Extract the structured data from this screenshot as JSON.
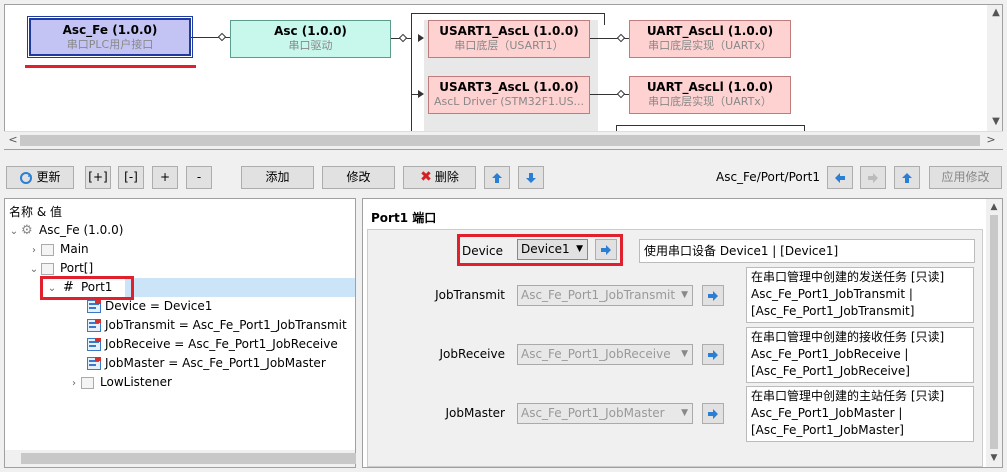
{
  "diagram": {
    "nodes": {
      "asc_fe": {
        "title": "Asc_Fe (1.0.0)",
        "sub": "串口PLC用户接口"
      },
      "asc": {
        "title": "Asc (1.0.0)",
        "sub": "串口驱动"
      },
      "usart1": {
        "title": "USART1_AscL (1.0.0)",
        "sub": "串口底层（USART1）"
      },
      "uart1": {
        "title": "UART_AscLl (1.0.0)",
        "sub": "串口底层实现（UARTx）"
      },
      "usart3": {
        "title": "USART3_AscL (1.0.0)",
        "sub": "AscL Driver (STM32F1.US..."
      },
      "uart2": {
        "title": "UART_AscLl (1.0.0)",
        "sub": "串口底层实现（UARTx）"
      }
    }
  },
  "toolbar": {
    "refresh": "更新",
    "expand": "[+]",
    "collapse": "[-]",
    "plus": "+",
    "minus": "-",
    "add": "添加",
    "edit": "修改",
    "delete": "删除",
    "path": "Asc_Fe/Port/Port1",
    "apply": "应用修改"
  },
  "tree": {
    "header": "名称 & 值",
    "root": "Asc_Fe (1.0.0)",
    "main": "Main",
    "port": "Port[]",
    "port1": "Port1",
    "device": "Device = Device1",
    "jobtransmit": "JobTransmit = Asc_Fe_Port1_JobTransmit",
    "jobreceive": "JobReceive = Asc_Fe_Port1_JobReceive",
    "jobmaster": "JobMaster = Asc_Fe_Port1_JobMaster",
    "lowlistener": "LowListener"
  },
  "detail": {
    "title": "Port1 端口",
    "params": {
      "device": {
        "label": "Device",
        "value": "Device1",
        "desc": "使用串口设备 Device1 | [Device1]"
      },
      "jobtransmit": {
        "label": "JobTransmit",
        "value": "Asc_Fe_Port1_JobTransmit",
        "desc1": "在串口管理中创建的发送任务 [只读]",
        "desc2": "Asc_Fe_Port1_JobTransmit |",
        "desc3": "[Asc_Fe_Port1_JobTransmit]"
      },
      "jobreceive": {
        "label": "JobReceive",
        "value": "Asc_Fe_Port1_JobReceive",
        "desc1": "在串口管理中创建的接收任务 [只读]",
        "desc2": "Asc_Fe_Port1_JobReceive |",
        "desc3": "[Asc_Fe_Port1_JobReceive]"
      },
      "jobmaster": {
        "label": "JobMaster",
        "value": "Asc_Fe_Port1_JobMaster",
        "desc1": "在串口管理中创建的主站任务 [只读]",
        "desc2": "Asc_Fe_Port1_JobMaster |",
        "desc3": "[Asc_Fe_Port1_JobMaster]"
      }
    }
  },
  "colors": {
    "highlight": "#e0202c",
    "selected_node": "#c4c4f4",
    "accent": "#1f6fd0"
  }
}
